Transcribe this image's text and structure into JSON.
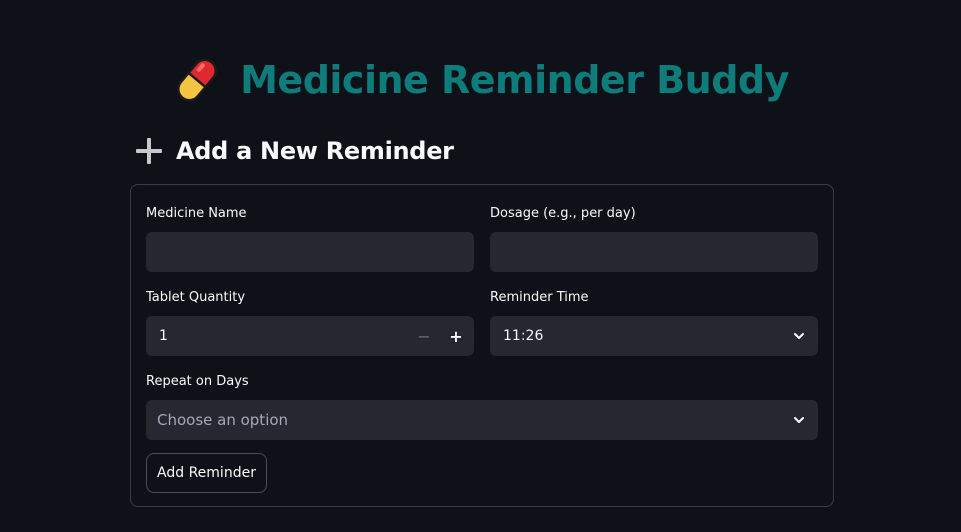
{
  "app": {
    "title": "Medicine Reminder Buddy",
    "title_icon": "pill-icon",
    "accent_color": "#0e7c7b"
  },
  "section": {
    "title": "Add a New Reminder",
    "icon": "plus-icon"
  },
  "form": {
    "medicine_name": {
      "label": "Medicine Name",
      "value": ""
    },
    "dosage": {
      "label": "Dosage (e.g., per day)",
      "value": ""
    },
    "tablet_quantity": {
      "label": "Tablet Quantity",
      "value": "1",
      "minus": "−",
      "plus": "+"
    },
    "reminder_time": {
      "label": "Reminder Time",
      "value": "11:26"
    },
    "repeat_days": {
      "label": "Repeat on Days",
      "placeholder": "Choose an option"
    },
    "submit_label": "Add Reminder"
  }
}
